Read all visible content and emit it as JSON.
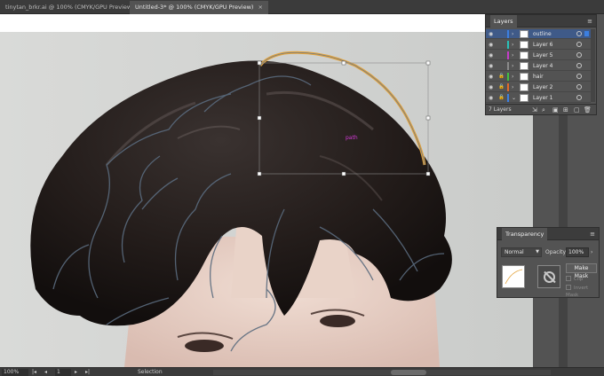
{
  "tabs": [
    {
      "label": "tinytan_brkr.ai @ 100% (CMYK/GPU Preview)",
      "close": "×",
      "active": false
    },
    {
      "label": "Untitled-3* @ 100% (CMYK/GPU Preview)",
      "close": "×",
      "active": true
    }
  ],
  "canvas": {
    "path_label": "path",
    "icons": [
      "hair-photo",
      "outline-path",
      "selection-bounding-box"
    ],
    "colors": {
      "outline_stroke": "#e3a23a",
      "guide_stroke": "#5a6b7e",
      "selection_box": "#8a8a8a"
    }
  },
  "layers_panel": {
    "title": "Layers",
    "menu_icon": "≡",
    "layers": [
      {
        "name": "outline",
        "color": "#3c7fe0",
        "selected": true,
        "locked": false,
        "expanded": false
      },
      {
        "name": "Layer 6",
        "color": "#29c0b8",
        "selected": false,
        "locked": false,
        "expanded": false
      },
      {
        "name": "Layer 5",
        "color": "#c43cc9",
        "selected": false,
        "locked": false,
        "expanded": false
      },
      {
        "name": "Layer 4",
        "color": "#8a8a8a",
        "selected": false,
        "locked": false,
        "expanded": false
      },
      {
        "name": "hair",
        "color": "#3fc43f",
        "selected": false,
        "locked": true,
        "expanded": false
      },
      {
        "name": "Layer 2",
        "color": "#e06a2a",
        "selected": false,
        "locked": true,
        "expanded": false
      },
      {
        "name": "Layer 1",
        "color": "#3c7fe0",
        "selected": false,
        "locked": true,
        "expanded": true
      }
    ],
    "footer_count": "7 Layers",
    "footer_icons": [
      "export-icon",
      "search-icon",
      "clip-icon",
      "new-sublayer-icon",
      "new-layer-icon",
      "delete-icon"
    ]
  },
  "transparency_panel": {
    "title": "Transparency",
    "menu_icon": "≡",
    "blend_mode": "Normal",
    "opacity_label": "Opacity:",
    "opacity_value": "100%",
    "make_mask_label": "Make Mask",
    "clip_label": "Clip",
    "invert_mask_label": "Invert Mask"
  },
  "status_bar": {
    "zoom": "100%",
    "page": "1",
    "tool": "Selection",
    "nav_first": "|◂",
    "nav_prev": "◂",
    "nav_next": "▸",
    "nav_last": "▸|"
  }
}
